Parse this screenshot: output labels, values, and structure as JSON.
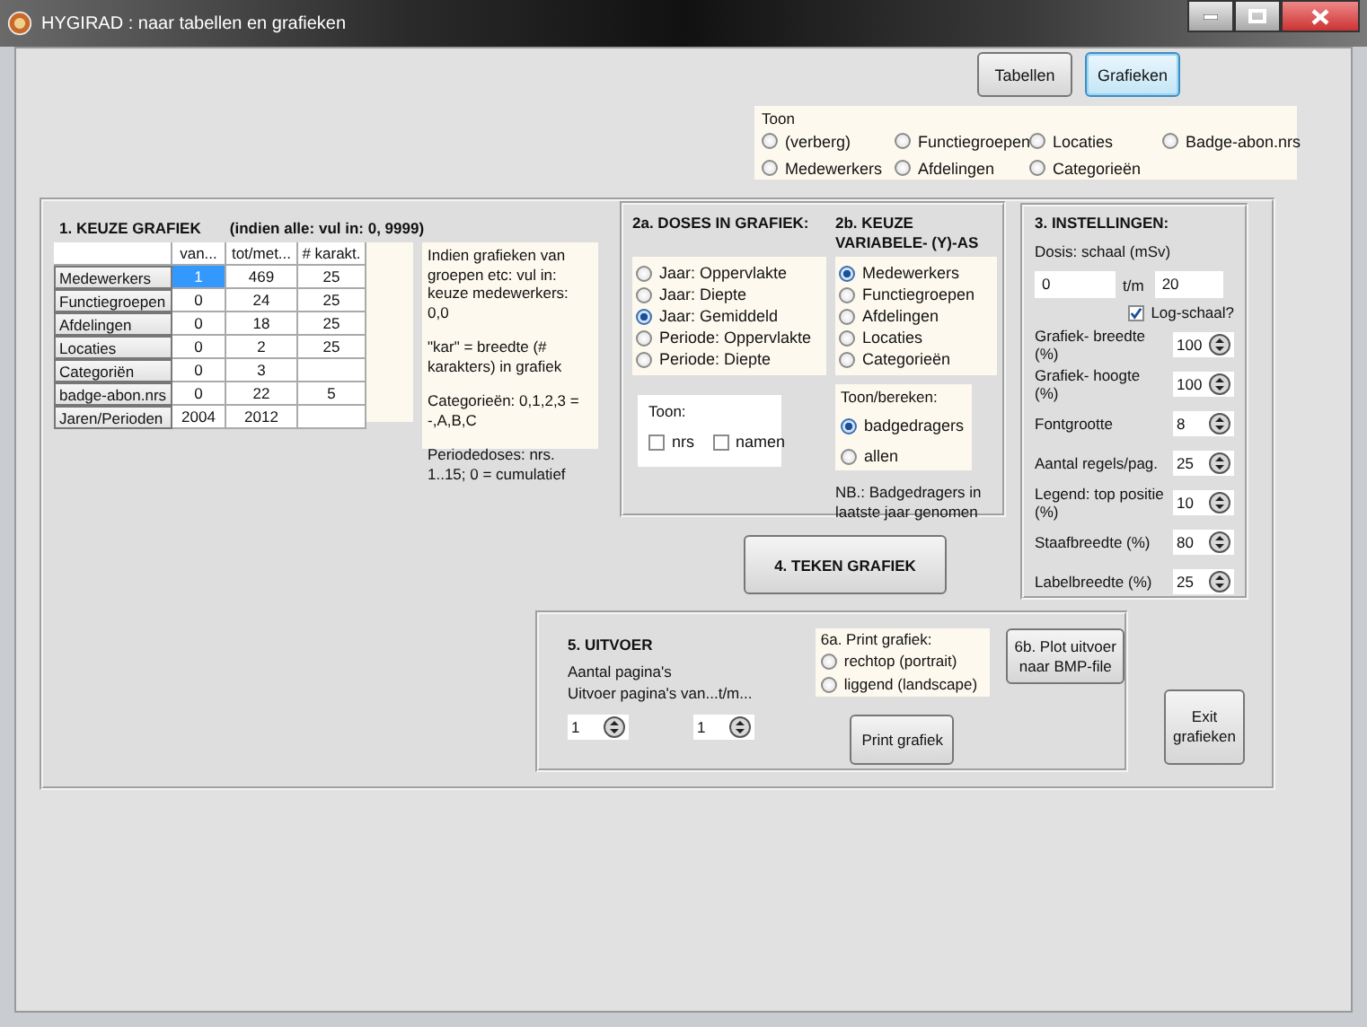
{
  "window": {
    "title": "HYGIRAD : naar tabellen en grafieken"
  },
  "top_buttons": [
    {
      "label": "Tabellen",
      "selected": false
    },
    {
      "label": "Grafieken",
      "selected": true
    }
  ],
  "toon": {
    "title": "Toon",
    "options": [
      {
        "label": "(verberg)",
        "selected": false
      },
      {
        "label": "Medewerkers",
        "selected": false
      },
      {
        "label": "Functiegroepen",
        "selected": false
      },
      {
        "label": "Afdelingen",
        "selected": false
      },
      {
        "label": "Locaties",
        "selected": false
      },
      {
        "label": "Categorieën",
        "selected": false
      },
      {
        "label": "Badge-abon.nrs",
        "selected": false
      }
    ]
  },
  "section1": {
    "title": "1. KEUZE GRAFIEK",
    "hint": "(indien alle: vul in:  0, 9999)",
    "table": {
      "columns": [
        "van...",
        "tot/met...",
        "# karakt."
      ],
      "rows": [
        {
          "label": "Medewerkers",
          "cells": [
            {
              "text": "1",
              "selected": true
            },
            {
              "text": "469",
              "selected": false
            },
            {
              "text": "25",
              "selected": false
            }
          ]
        },
        {
          "label": "Functiegroepen",
          "cells": [
            {
              "text": "0",
              "selected": false
            },
            {
              "text": "24",
              "selected": false
            },
            {
              "text": "25",
              "selected": false
            }
          ]
        },
        {
          "label": "Afdelingen",
          "cells": [
            {
              "text": "0",
              "selected": false
            },
            {
              "text": "18",
              "selected": false
            },
            {
              "text": "25",
              "selected": false
            }
          ]
        },
        {
          "label": "Locaties",
          "cells": [
            {
              "text": "0",
              "selected": false
            },
            {
              "text": "2",
              "selected": false
            },
            {
              "text": "25",
              "selected": false
            }
          ]
        },
        {
          "label": "Categoriën",
          "cells": [
            {
              "text": "0",
              "selected": false
            },
            {
              "text": "3",
              "selected": false
            },
            {
              "selected": false
            }
          ]
        },
        {
          "label": "badge-abon.nrs",
          "cells": [
            {
              "text": "0",
              "selected": false
            },
            {
              "text": "22",
              "selected": false
            },
            {
              "text": "5",
              "selected": false
            }
          ]
        },
        {
          "label": "Jaren/Perioden",
          "cells": [
            {
              "text": "2004",
              "selected": false
            },
            {
              "text": "2012",
              "selected": false
            },
            {
              "selected": false
            }
          ]
        }
      ]
    },
    "notes": [
      "Indien grafieken van groepen etc: vul in: keuze medewerkers: 0,0",
      "\"kar\" = breedte (# karakters) in grafiek",
      "Categorieën: 0,1,2,3 = -,A,B,C",
      "Periodedoses: nrs. 1..15; 0 = cumulatief"
    ]
  },
  "section2a": {
    "title": "2a. DOSES IN GRAFIEK:",
    "options": [
      {
        "label": "Jaar: Oppervlakte",
        "selected": false
      },
      {
        "label": "Jaar: Diepte",
        "selected": false
      },
      {
        "label": "Jaar: Gemiddeld",
        "selected": true
      },
      {
        "label": "Periode: Oppervlakte",
        "selected": false
      },
      {
        "label": "Periode: Diepte",
        "selected": false
      }
    ]
  },
  "section2b": {
    "title": "2b. KEUZE VARIABELE- (Y)-AS",
    "options": [
      {
        "label": "Medewerkers",
        "selected": true
      },
      {
        "label": "Functiegroepen",
        "selected": false
      },
      {
        "label": "Afdelingen",
        "selected": false
      },
      {
        "label": "Locaties",
        "selected": false
      },
      {
        "label": "Categorieën",
        "selected": false
      }
    ]
  },
  "toon_box": {
    "title": "Toon:",
    "checkboxes": [
      {
        "label": "nrs",
        "checked": false
      },
      {
        "label": "namen",
        "checked": false
      }
    ]
  },
  "toon_bereken": {
    "title": "Toon/bereken:",
    "options": [
      {
        "label": "badgedragers",
        "selected": true
      },
      {
        "label": "allen",
        "selected": false
      }
    ]
  },
  "note_2b": "NB.: Badgedragers in laatste jaar genomen",
  "section3": {
    "title": "3. INSTELLINGEN:",
    "scale_label": "Dosis: schaal (mSv)",
    "scale_from": "0",
    "scale_sep": "t/m",
    "scale_to": "20",
    "log_scale": {
      "label": "Log-schaal?",
      "checked": true
    },
    "settings": [
      {
        "label": "Grafiek- breedte (%)",
        "value": "100"
      },
      {
        "label": "Grafiek- hoogte (%)",
        "value": "100"
      },
      {
        "label": "Fontgrootte",
        "value": "8"
      },
      {
        "label": "Aantal regels/pag.",
        "value": "25"
      },
      {
        "label": "Legend: top positie (%)",
        "value": "10"
      },
      {
        "label": "Staafbreedte  (%)",
        "value": "80"
      },
      {
        "label": "Labelbreedte (%)",
        "value": "25"
      }
    ]
  },
  "draw_button": "4. TEKEN GRAFIEK",
  "section5": {
    "title": "5. UITVOER",
    "lines": [
      "Aantal pagina's",
      "Uitvoer pagina's van...t/m..."
    ],
    "page_from": "1",
    "page_to": "1",
    "print_group": {
      "title": "6a.  Print grafiek:",
      "options": [
        {
          "label": "rechtop (portrait)",
          "selected": false
        },
        {
          "label": "liggend (landscape)",
          "selected": false
        }
      ]
    },
    "print_button": "Print grafiek",
    "plot_button": "6b. Plot uitvoer naar BMP-file"
  },
  "exit_button": "Exit grafieken"
}
